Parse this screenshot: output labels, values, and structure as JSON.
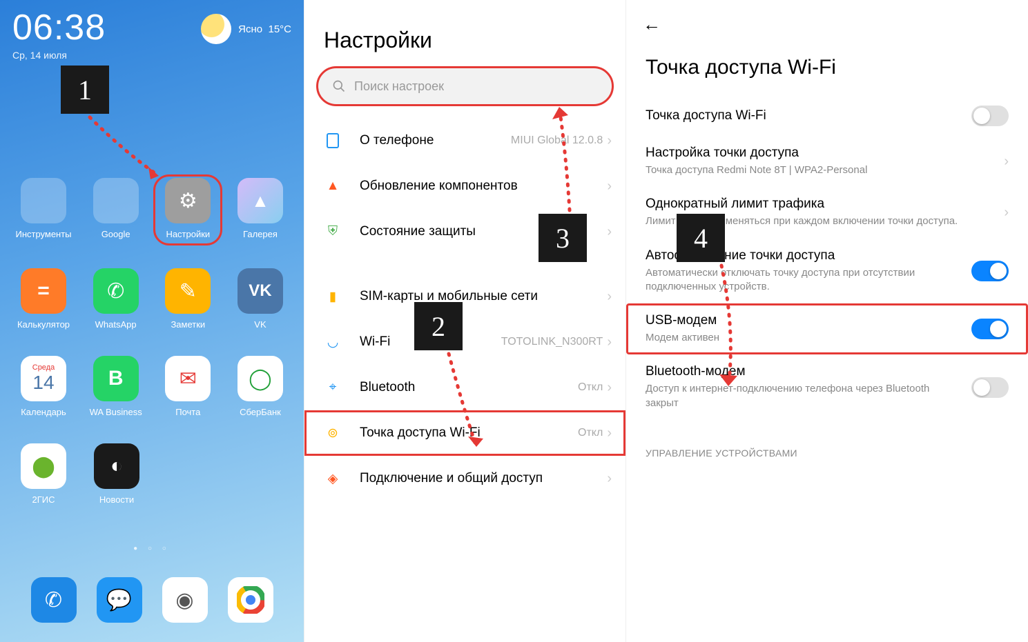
{
  "steps": {
    "s1": "1",
    "s2": "2",
    "s3": "3",
    "s4": "4"
  },
  "home": {
    "clock": "06:38",
    "date": "Ср, 14 июля",
    "weather_cond": "Ясно",
    "weather_temp": "15°C",
    "apps": {
      "r1": [
        {
          "label": "Инструменты"
        },
        {
          "label": "Google"
        },
        {
          "label": "Настройки"
        },
        {
          "label": "Галерея"
        }
      ],
      "r2": [
        {
          "label": "Калькулятор"
        },
        {
          "label": "WhatsApp"
        },
        {
          "label": "Заметки"
        },
        {
          "label": "VK"
        }
      ],
      "r3": [
        {
          "label": "Календарь",
          "badge_top": "Среда",
          "badge_num": "14"
        },
        {
          "label": "WA Business"
        },
        {
          "label": "Почта"
        },
        {
          "label": "СберБанк"
        }
      ],
      "r4": [
        {
          "label": "2ГИС"
        },
        {
          "label": "Новости"
        }
      ]
    }
  },
  "settings": {
    "title": "Настройки",
    "search_placeholder": "Поиск настроек",
    "items": [
      {
        "label": "О телефоне",
        "value": "MIUI Global 12.0.8"
      },
      {
        "label": "Обновление компонентов",
        "value": ""
      },
      {
        "label": "Состояние защиты",
        "value": ""
      },
      {
        "label": "SIM-карты и мобильные сети",
        "value": ""
      },
      {
        "label": "Wi-Fi",
        "value": "TOTOLINK_N300RT"
      },
      {
        "label": "Bluetooth",
        "value": "Откл"
      },
      {
        "label": "Точка доступа Wi-Fi",
        "value": "Откл"
      },
      {
        "label": "Подключение и общий доступ",
        "value": ""
      }
    ]
  },
  "hotspot": {
    "title": "Точка доступа Wi-Fi",
    "items": [
      {
        "main": "Точка доступа Wi-Fi",
        "sub": "",
        "toggle": "off"
      },
      {
        "main": "Настройка точки доступа",
        "sub": "Точка доступа Redmi Note 8T | WPA2-Personal"
      },
      {
        "main": "Однократный лимит трафика",
        "sub": "Лимит будет применяться при каждом включении точки доступа."
      },
      {
        "main": "Автоотключение точки доступа",
        "sub": "Автоматически отключать точку доступа при отсутствии подключенных устройств.",
        "toggle": "on"
      },
      {
        "main": "USB-модем",
        "sub": "Модем активен",
        "toggle": "on"
      },
      {
        "main": "Bluetooth-модем",
        "sub": "Доступ к интернет-подключению телефона через Bluetooth закрыт",
        "toggle": "off"
      }
    ],
    "section": "УПРАВЛЕНИЕ УСТРОЙСТВАМИ"
  }
}
